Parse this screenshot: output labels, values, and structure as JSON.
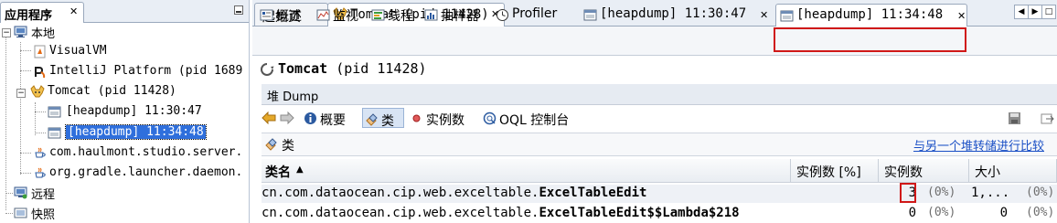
{
  "left_panel": {
    "tab_title": "应用程序",
    "tree": {
      "local": "本地",
      "visualvm": "VisualVM",
      "intellij": "IntelliJ Platform (pid 1689",
      "tomcat": "Tomcat (pid 11428)",
      "heap1": "[heapdump] 11:30:47",
      "heap2": "[heapdump] 11:34:48",
      "haulmont": "com.haulmont.studio.server.",
      "gradle": "org.gradle.launcher.daemon.",
      "remote": "远程",
      "snapshots": "快照"
    }
  },
  "doc_tabs": [
    {
      "label": "起始页"
    },
    {
      "label": "Tomcat (pid 11428)"
    }
  ],
  "sub_tabs": [
    {
      "label": "概述"
    },
    {
      "label": "监视"
    },
    {
      "label": "线程"
    },
    {
      "label": "抽样器"
    },
    {
      "label": "Profiler"
    },
    {
      "label": "[heapdump] 11:30:47"
    },
    {
      "label": "[heapdump] 11:34:48"
    }
  ],
  "header": {
    "title_bold": "Tomcat",
    "title_rest": " (pid 11428)",
    "section": "堆 Dump"
  },
  "toolbar": {
    "summary": "概要",
    "classes": "类",
    "instances": "实例数",
    "oql": "OQL 控制台"
  },
  "classes_view": {
    "title": "类",
    "compare_link": "与另一个堆转储进行比较"
  },
  "table": {
    "columns": [
      "类名",
      "实例数 [%]",
      "实例数",
      "大小"
    ],
    "rows": [
      {
        "pkg": "cn.com.dataocean.cip.web.exceltable.",
        "cls": "ExcelTableEdit",
        "instances": "3",
        "inst_pct": "(0%)",
        "size": "1,...",
        "size_pct": "(0%)"
      },
      {
        "pkg": "cn.com.dataocean.cip.web.exceltable.",
        "cls": "ExcelTableEdit$$Lambda$218",
        "instances": "0",
        "inst_pct": "(0%)",
        "size": "0",
        "size_pct": "(0%)"
      }
    ]
  },
  "colors": {
    "selection": "#2f6fdc",
    "highlight_box": "#d01818",
    "link": "#1a4fc5"
  }
}
